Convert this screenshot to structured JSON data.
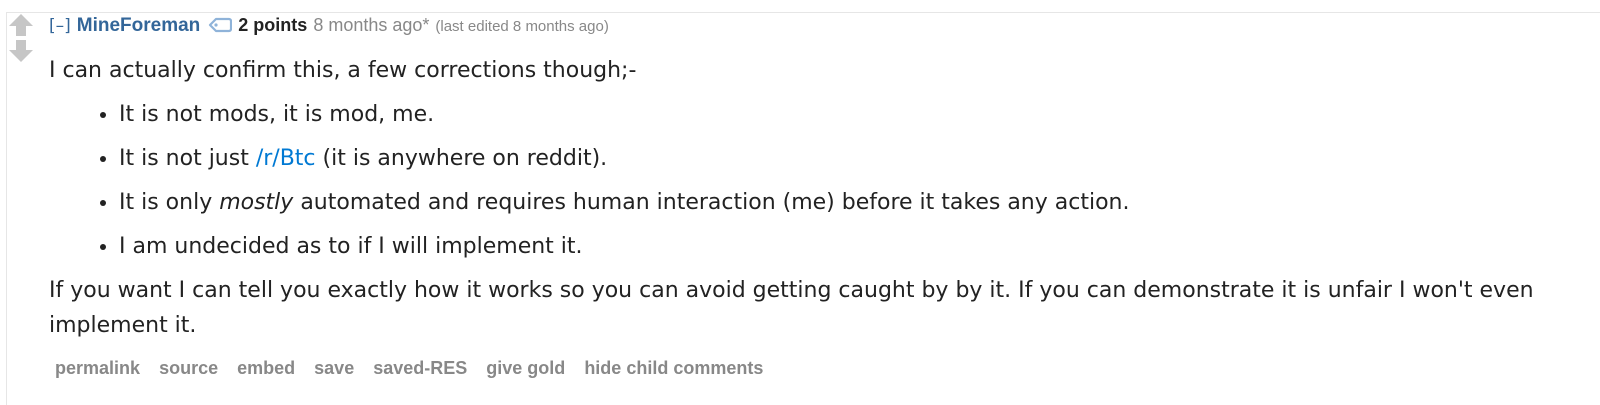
{
  "comment": {
    "collapse_label": "[–]",
    "author": "MineForeman",
    "score": "2 points",
    "time": "8 months ago*",
    "edited": "(last edited 8 months ago)",
    "body": {
      "intro": "I can actually confirm this, a few corrections though;-",
      "bullet_1": "It is not mods, it is mod, me.",
      "bullet_2_pre": "It is not just ",
      "bullet_2_link": "/r/Btc",
      "bullet_2_post": " (it is anywhere on reddit).",
      "bullet_3_pre": "It is only ",
      "bullet_3_em": "mostly",
      "bullet_3_post": " automated and requires human interaction (me) before it takes any action.",
      "bullet_4": "I am undecided as to if I will implement it.",
      "closing": "If you want I can tell you exactly how it works so you can avoid getting caught by by it. If you can demonstrate it is unfair I won't even implement it."
    },
    "buttons": {
      "permalink": "permalink",
      "source": "source",
      "embed": "embed",
      "save": "save",
      "saved_res": "saved-RES",
      "give_gold": "give gold",
      "hide_child": "hide child comments"
    }
  },
  "colors": {
    "author": "#336699",
    "link": "#0079d3",
    "muted": "#888888",
    "arrow": "#c6c6c6"
  },
  "icons": {
    "upvote": "up-arrow-icon",
    "downvote": "down-arrow-icon",
    "user_tag": "tag-icon"
  }
}
